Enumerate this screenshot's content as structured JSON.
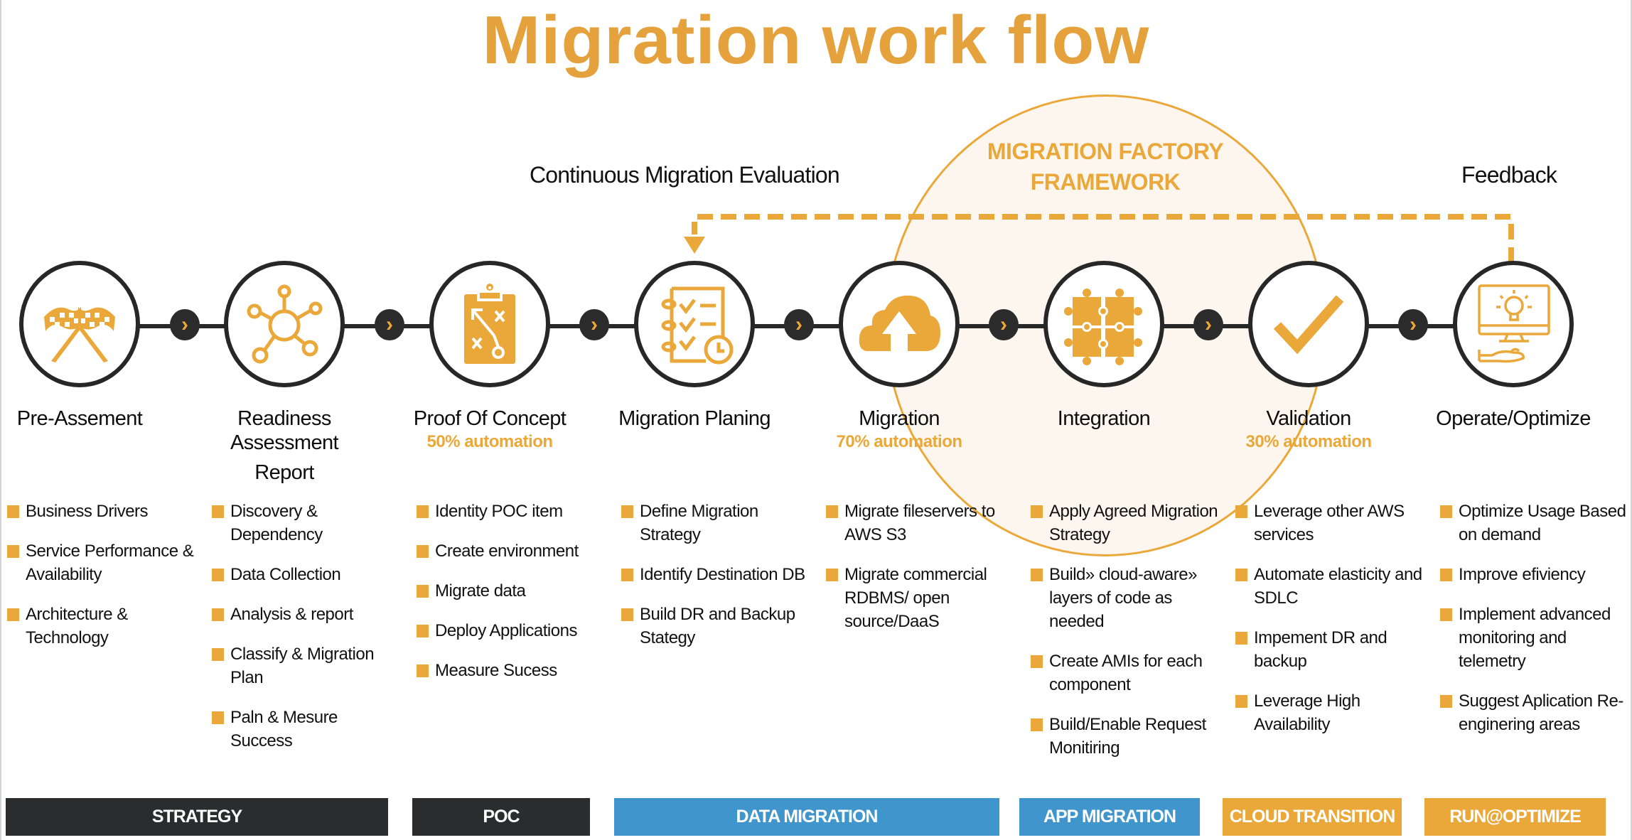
{
  "title": "Migration work flow",
  "colors": {
    "accent": "#eba83a",
    "title": "#e5a23c",
    "dark": "#2b2b2b",
    "blue": "#4096cc",
    "factory_fill": "#fdf6ef"
  },
  "factory": {
    "line1": "MIGRATION FACTORY",
    "line2": "FRAMEWORK"
  },
  "loop": {
    "left_label": "Continuous Migration Evaluation",
    "right_label": "Feedback"
  },
  "steps": [
    {
      "icon": "checkered-flags-icon",
      "title": [
        "Pre-Assement"
      ],
      "automation": "",
      "bullets": [
        "Business Drivers",
        "Service Performance & Availability",
        "Architecture & Technology"
      ]
    },
    {
      "icon": "network-hub-icon",
      "title": [
        "Readiness",
        "Assessment",
        "Report"
      ],
      "automation": "",
      "bullets": [
        "Discovery & Dependency",
        "Data Collection",
        "Analysis & report",
        "Classify & Migration Plan",
        "Paln & Mesure Success"
      ]
    },
    {
      "icon": "clipboard-strategy-icon",
      "title": [
        "Proof Of Concept"
      ],
      "automation": "50% automation",
      "bullets": [
        "Identity POC item",
        "Create environment",
        "Migrate data",
        "Deploy Applications",
        "Measure Sucess"
      ]
    },
    {
      "icon": "checklist-clock-icon",
      "title": [
        "Migration Planing"
      ],
      "automation": "",
      "bullets": [
        "Define Migration Strategy",
        "Identify Destination DB",
        "Build DR and Backup Stategy"
      ]
    },
    {
      "icon": "cloud-upload-icon",
      "title": [
        "Migration"
      ],
      "automation": "70% automation",
      "bullets": [
        "Migrate fileservers to AWS S3",
        "Migrate commercial RDBMS/ open source/DaaS"
      ]
    },
    {
      "icon": "puzzle-pieces-icon",
      "title": [
        "Integration"
      ],
      "automation": "",
      "bullets": [
        "Apply Agreed Migration Strategy",
        "Build» cloud-aware» layers of code as needed",
        "Create AMIs for each component",
        "Build/Enable Request Monitiring"
      ]
    },
    {
      "icon": "checkmark-icon",
      "title": [
        "Validation"
      ],
      "automation": "30% automation",
      "bullets": [
        "Leverage other AWS services",
        "Automate elasticity and SDLC",
        "Impement DR and backup",
        "Leverage High Availability"
      ]
    },
    {
      "icon": "monitor-lightbulb-hand-icon",
      "title": [
        "Operate/Optimize"
      ],
      "automation": "",
      "bullets": [
        "Optimize Usage Based on demand",
        "Improve efiviency",
        "Implement advanced monitoring and telemetry",
        "Suggest Aplication Re-enginering areas"
      ]
    }
  ],
  "connector_glyph": "›",
  "phases": [
    {
      "label": "STRATEGY",
      "color": "#2b2c2e"
    },
    {
      "label": "POC",
      "color": "#2b2c2e"
    },
    {
      "label": "DATA MIGRATION",
      "color": "#4096cc"
    },
    {
      "label": "APP MIGRATION",
      "color": "#4096cc"
    },
    {
      "label": "CLOUD TRANSITION",
      "color": "#eba83a"
    },
    {
      "label": "RUN@OPTIMIZE",
      "color": "#eba83a"
    }
  ]
}
